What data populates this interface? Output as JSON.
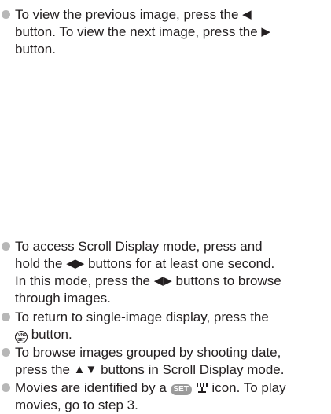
{
  "bullets": {
    "nav": {
      "line1_pre": "To view the previous image, press the ",
      "line2_pre": "button. To view the next image, press the ",
      "line3": "button."
    },
    "scroll": {
      "line1": "To access Scroll Display mode, press and",
      "line2_pre": "hold the ",
      "line2_post": " buttons for at least one second.",
      "line3_pre": "In this mode, press the ",
      "line3_post": " buttons to browse",
      "line4": "through images."
    },
    "single": {
      "line1": "To return to single-image display, press the",
      "line2_post": " button."
    },
    "date": {
      "line1": "To browse images grouped by shooting date,",
      "line2_pre": "press the ",
      "line2_post": " buttons in Scroll Display mode."
    },
    "movies": {
      "line1_pre": "Movies are identified by a ",
      "line1_post": " icon. To play",
      "line2": "movies, go to step 3."
    }
  },
  "icons": {
    "left": "left-arrow-button-icon",
    "right": "right-arrow-button-icon",
    "left_right": "left-right-arrow-buttons-icon",
    "up_down": "up-down-arrow-buttons-icon",
    "func_set": "func-set-button-icon",
    "set_movie": "set-movie-icon"
  },
  "icon_text": {
    "func_top": "FUNC",
    "func_bottom": "SET",
    "set": "SET"
  },
  "colors": {
    "bullet": "#b7b7b7",
    "text": "#231f20",
    "badge": "#9b9b9b"
  }
}
